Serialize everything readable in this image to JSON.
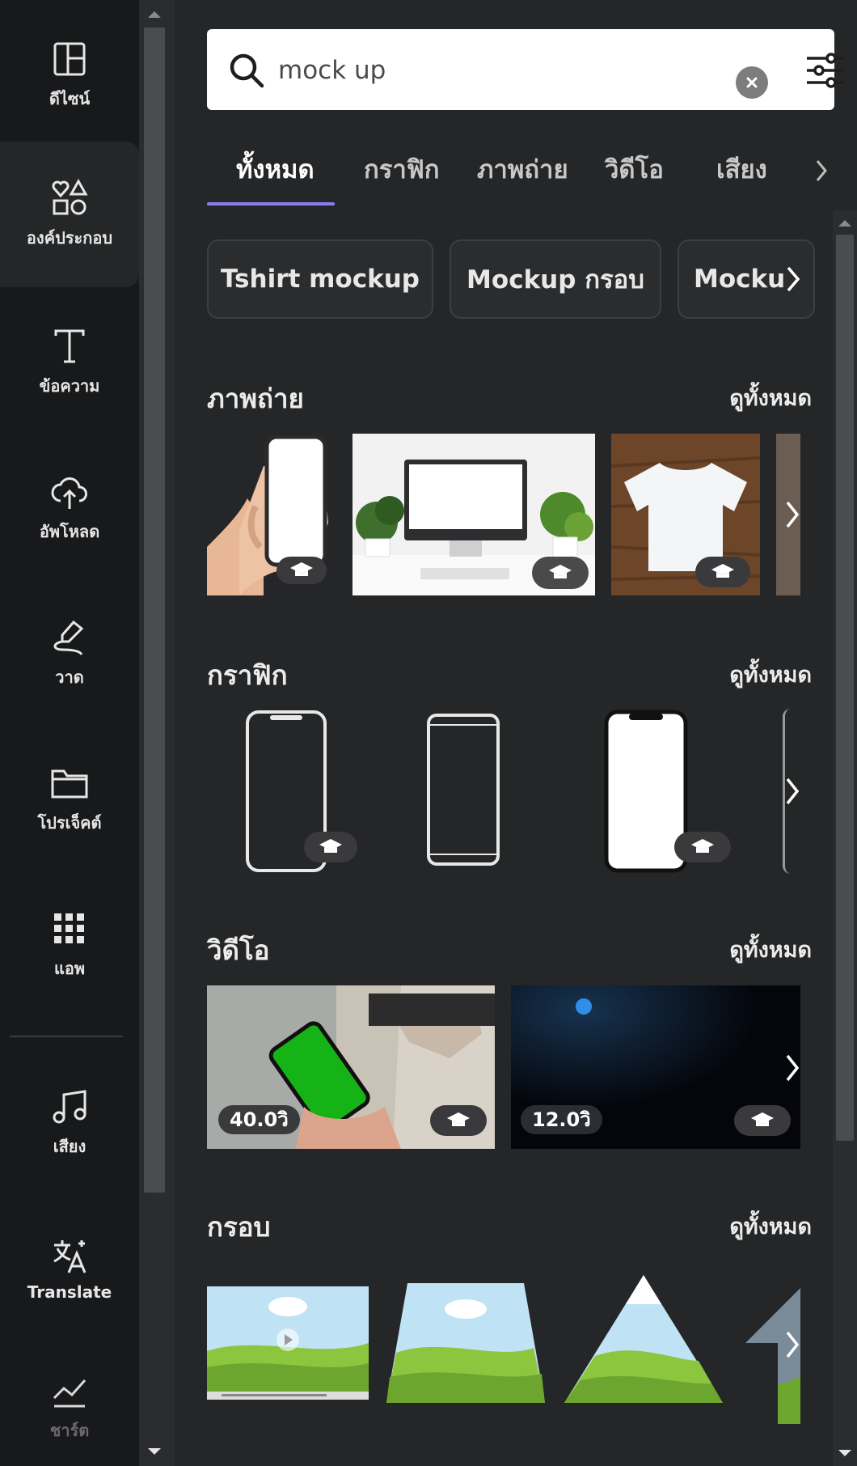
{
  "sidebar": {
    "items": [
      {
        "label": "ดีไซน์",
        "icon": "layout-icon"
      },
      {
        "label": "องค์ประกอบ",
        "icon": "shapes-icon",
        "selected": true
      },
      {
        "label": "ข้อความ",
        "icon": "text-icon"
      },
      {
        "label": "อัพโหลด",
        "icon": "cloud-upload-icon"
      },
      {
        "label": "วาด",
        "icon": "draw-icon"
      },
      {
        "label": "โปรเจ็คต์",
        "icon": "folder-icon"
      },
      {
        "label": "แอพ",
        "icon": "apps-grid-icon"
      },
      {
        "label": "เสียง",
        "icon": "music-note-icon"
      },
      {
        "label": "Translate",
        "icon": "translate-icon"
      },
      {
        "label": "ชาร์ต",
        "icon": "chart-icon"
      }
    ]
  },
  "search": {
    "value": "mock up",
    "placeholder": ""
  },
  "tabs": [
    "ทั้งหมด",
    "กราฟิก",
    "ภาพถ่าย",
    "วิดีโอ",
    "เสียง"
  ],
  "active_tab": "ทั้งหมด",
  "chips": [
    "Tshirt mockup",
    "Mockup กรอบ",
    "Mocku"
  ],
  "sections": {
    "photos": {
      "title": "ภาพถ่าย",
      "see_all": "ดูทั้งหมด"
    },
    "graphics": {
      "title": "กราฟิก",
      "see_all": "ดูทั้งหมด"
    },
    "videos": {
      "title": "วิดีโอ",
      "see_all": "ดูทั้งหมด",
      "durations": [
        "40.0วิ",
        "12.0วิ"
      ]
    },
    "frames": {
      "title": "กรอบ",
      "see_all": "ดูทั้งหมด"
    }
  },
  "colors": {
    "accent": "#8b7cf6",
    "panel": "#252627",
    "rail": "#18191b"
  }
}
